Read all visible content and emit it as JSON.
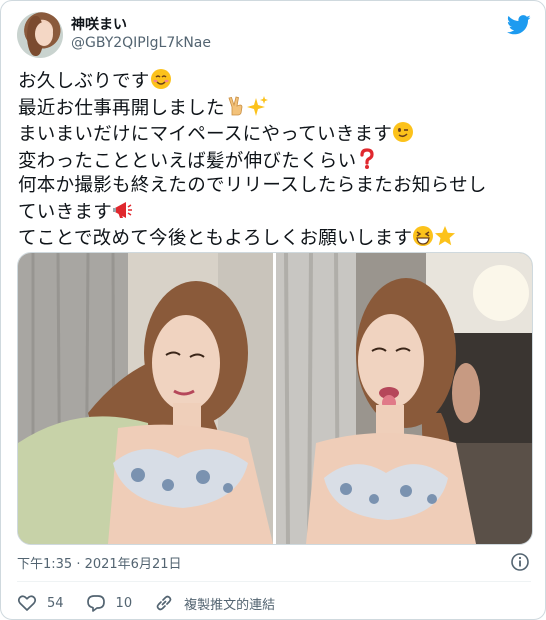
{
  "author": {
    "display_name": "神咲まい",
    "handle": "@GBY2QIPlgL7kNae",
    "avatar_icon": "profile-avatar"
  },
  "brand": {
    "icon": "twitter-bird-icon",
    "color": "#1d9bf0"
  },
  "tweet": {
    "lines": [
      "お久しぶりです",
      "最近お仕事再開しました",
      "まいまいだけにマイペースにやっていきます",
      "変わったことといえば髪が伸びたくらい",
      "何本か撮影も終えたのでリリースしたらまたお知らせし",
      "ていきます",
      "てことで改めて今後ともよろしくお願いします"
    ],
    "emojis": {
      "line1": "smiling-face-emoji",
      "line2": [
        "victory-hand-emoji",
        "sparkles-emoji"
      ],
      "line3": "winking-face-emoji",
      "line4": "red-question-mark-emoji",
      "line6": "megaphone-emoji",
      "line7": [
        "grinning-squinting-face-emoji",
        "star-emoji"
      ]
    }
  },
  "media": {
    "count": 2
  },
  "timestamp": "下午1:35 · 2021年6月21日",
  "actions": {
    "like_count": "54",
    "reply_count": "10",
    "copy_link_label": "複製推文的連結"
  },
  "colors": {
    "text": "#0f1419",
    "secondary": "#536471",
    "border": "#cfd9de",
    "accent": "#1d9bf0"
  }
}
